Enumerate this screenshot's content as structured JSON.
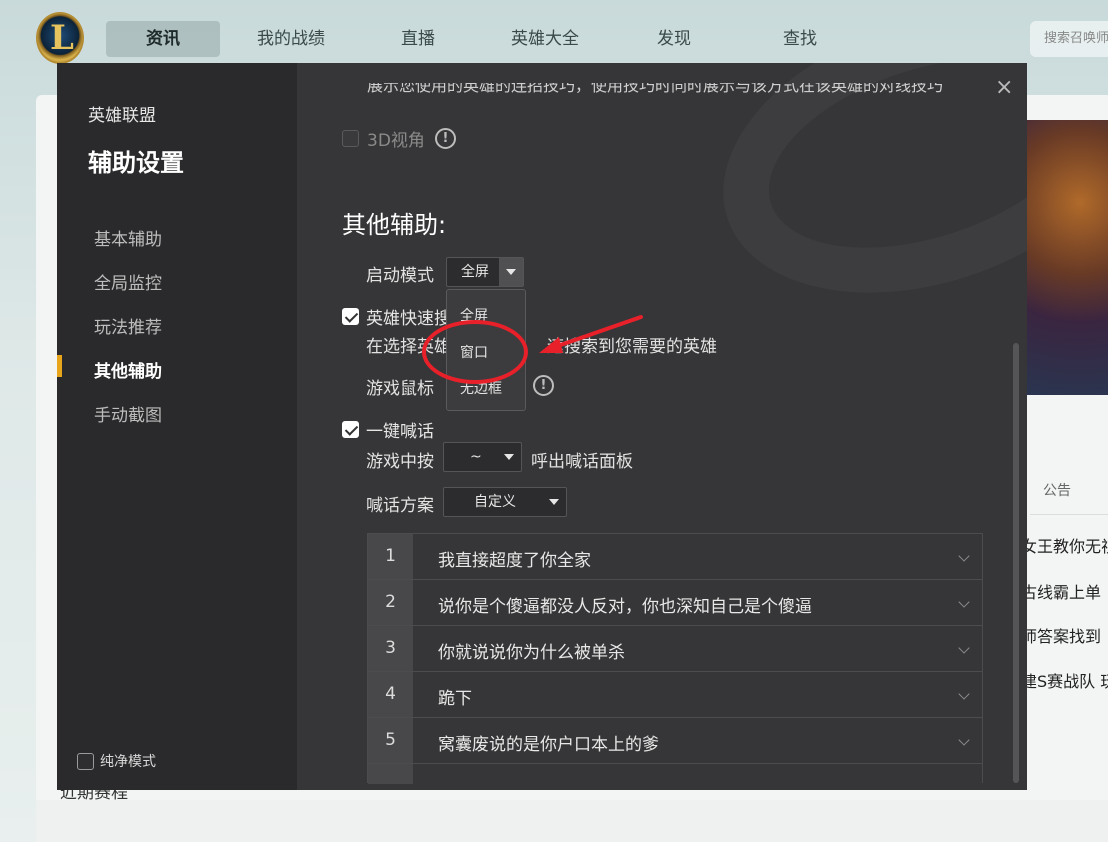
{
  "topnav": {
    "logo_letter": "L",
    "items": [
      "资讯",
      "我的战绩",
      "直播",
      "英雄大全",
      "发现",
      "查找"
    ],
    "active_index": 0,
    "search_placeholder": "搜索召唤师"
  },
  "background": {
    "tab_label": "公告",
    "news": [
      "女王教你无视",
      "古线霸上单",
      "师答案找到",
      "建S赛战队 玩"
    ],
    "bottom_title": "近期赛程"
  },
  "modal": {
    "close_symbol": "×",
    "sidebar": {
      "app_name": "英雄联盟",
      "title": "辅助设置",
      "items": [
        "基本辅助",
        "全局监控",
        "玩法推荐",
        "其他辅助",
        "手动截图"
      ],
      "active_index": 3,
      "pure_mode_label": "纯净模式",
      "pure_mode_checked": false
    },
    "content": {
      "cut_text": "展示您使用的英雄的连招技巧，使用技巧时同时展示与该方式在该英雄的对线技巧",
      "three_d": {
        "label": "3D视角",
        "checked": false,
        "disabled": true,
        "info": "!"
      },
      "section_title": "其他辅助:",
      "launch_mode": {
        "label": "启动模式",
        "value": "全屏",
        "options": [
          "全屏",
          "窗口",
          "无边框"
        ]
      },
      "hero_search": {
        "label": "英雄快速搜索",
        "checked": true,
        "desc_prefix": "在选择英雄",
        "desc_suffix": "速搜索到您需要的英雄"
      },
      "game_cursor": {
        "label": "游戏鼠标",
        "info": "!"
      },
      "one_key_shout": {
        "label": "一键喊话",
        "checked": true,
        "hotkey_prefix": "游戏中按",
        "hotkey_value": "~",
        "hotkey_suffix": "呼出喊话面板",
        "plan_label": "喊话方案",
        "plan_value": "自定义"
      },
      "phrases": [
        {
          "num": "1",
          "text": "我直接超度了你全家"
        },
        {
          "num": "2",
          "text": "说你是个傻逼都没人反对，你也深知自己是个傻逼"
        },
        {
          "num": "3",
          "text": "你就说说你为什么被单杀"
        },
        {
          "num": "4",
          "text": "跪下"
        },
        {
          "num": "5",
          "text": "窝囊废说的是你户口本上的爹"
        }
      ]
    }
  },
  "colors": {
    "accent": "#e7a51b",
    "annotation_red": "#e8202a",
    "modal_bg": "#363638",
    "sidebar_bg": "#2a2a2c"
  }
}
